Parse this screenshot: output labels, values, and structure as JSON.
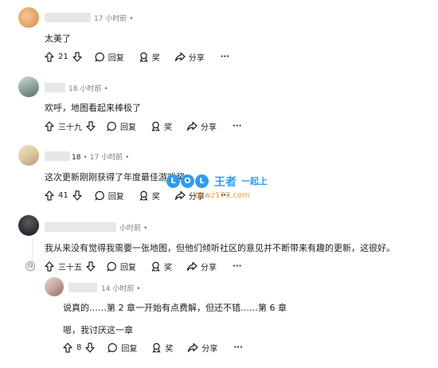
{
  "comments": [
    {
      "user_suffix": "",
      "time": "17 小时前",
      "text": "太美了",
      "votes": "21",
      "reply": "回复",
      "award": "奖",
      "share": "分享",
      "more": "···"
    },
    {
      "user_suffix": "",
      "time": "18 小时前",
      "text": "欢呼，地图看起来棒极了",
      "votes": "三十九",
      "reply": "回复",
      "award": "奖",
      "share": "分享",
      "more": "···"
    },
    {
      "user_suffix": "18",
      "time": "17 小时前",
      "text": "这次更新刚刚获得了年度最佳游戏奖",
      "votes": "41",
      "reply": "回复",
      "award": "奖",
      "share": "分享",
      "more": "···"
    },
    {
      "user_suffix": "",
      "time": "小时前",
      "text": "我从来没有觉得我需要一张地图，但他们倾听社区的意见并不断带来有趣的更新，这很好。",
      "votes": "三十五",
      "reply": "回复",
      "award": "奖",
      "share": "分享",
      "more": "···",
      "collapse": "⊖"
    },
    {
      "user_suffix": "",
      "time": "14 小时前",
      "text": "说真的……第 2 章一开始有点费解，但还不错……第 6 章",
      "text2": "嗯，我讨厌这一章",
      "votes": "8",
      "reply": "回复",
      "award": "奖",
      "share": "分享",
      "more": "···"
    }
  ],
  "watermark": {
    "letters": [
      "L",
      "O",
      "L"
    ],
    "name": "王者",
    "tag": "一起上",
    "url": "lolwz173.com"
  },
  "icons": {
    "upvote": "arrow-up-icon",
    "downvote": "arrow-down-icon",
    "reply": "comment-bubble-icon",
    "award": "award-icon",
    "share": "share-arrow-icon",
    "more": "more-icon"
  },
  "colors": {
    "meta": "#7c7c7c",
    "thread_line": "#e6e6e8",
    "watermark_blue": "#2f9cf0",
    "watermark_orange": "#e8a13b"
  }
}
